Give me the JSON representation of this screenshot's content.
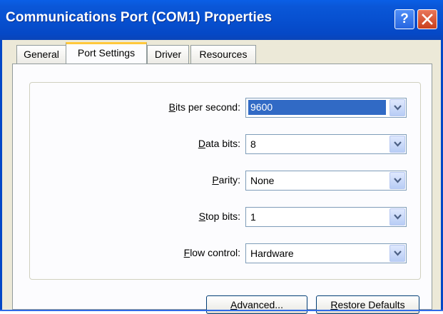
{
  "window": {
    "title": "Communications Port (COM1) Properties",
    "help_label": "?",
    "close_icon": "close-icon"
  },
  "tabs": [
    {
      "label": "General",
      "active": false
    },
    {
      "label": "Port Settings",
      "active": true
    },
    {
      "label": "Driver",
      "active": false
    },
    {
      "label": "Resources",
      "active": false
    }
  ],
  "settings": {
    "bits_per_second": {
      "label_prefix": "",
      "mnemonic": "B",
      "label_rest": "its per second:",
      "value": "9600"
    },
    "data_bits": {
      "label_prefix": "",
      "mnemonic": "D",
      "label_rest": "ata bits:",
      "value": "8"
    },
    "parity": {
      "label_prefix": "",
      "mnemonic": "P",
      "label_rest": "arity:",
      "value": "None"
    },
    "stop_bits": {
      "label_prefix": "",
      "mnemonic": "S",
      "label_rest": "top bits:",
      "value": "1"
    },
    "flow_control": {
      "label_prefix": "",
      "mnemonic": "F",
      "label_rest": "low control:",
      "value": "Hardware"
    }
  },
  "buttons": {
    "advanced_prefix": "",
    "advanced_mnemonic": "A",
    "advanced_rest": "dvanced...",
    "restore_prefix": "",
    "restore_mnemonic": "R",
    "restore_rest": "estore Defaults"
  },
  "colors": {
    "titlebar": "#0548c6",
    "selection": "#316ac5",
    "active_tab_accent": "#ffc83c"
  }
}
